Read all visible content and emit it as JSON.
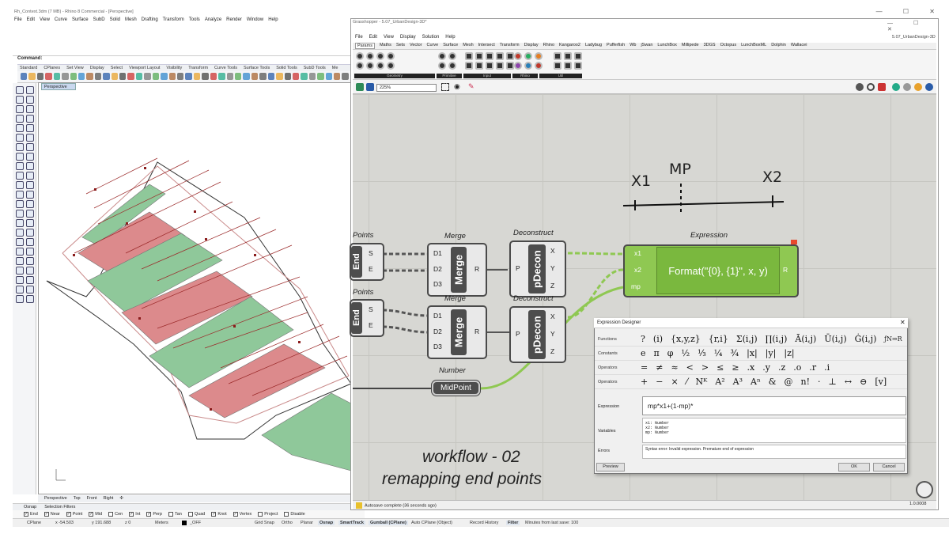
{
  "rhino": {
    "title": "Rh_Context.3dm (7 MB) - Rhino 8 Commercial - [Perspective]",
    "window_controls": "— ☐ ✕",
    "menu": [
      "File",
      "Edit",
      "View",
      "Curve",
      "Surface",
      "SubD",
      "Solid",
      "Mesh",
      "Drafting",
      "Transform",
      "Tools",
      "Analyze",
      "Render",
      "Window",
      "Help"
    ],
    "command_label": "Command:",
    "toolbar_tabs": [
      "Standard",
      "CPlanes",
      "Set View",
      "Display",
      "Select",
      "Viewport Layout",
      "Visibility",
      "Transform",
      "Curve Tools",
      "Surface Tools",
      "Solid Tools",
      "SubD Tools",
      "Me"
    ],
    "viewport_label": "Perspective",
    "viewport_tabs": [
      "Perspective",
      "Top",
      "Front",
      "Right",
      "✣"
    ],
    "osnap_tabs": [
      "Osnap",
      "Selection Filters"
    ],
    "osnaps": [
      {
        "label": "End",
        "checked": true
      },
      {
        "label": "Near",
        "checked": true
      },
      {
        "label": "Point",
        "checked": true
      },
      {
        "label": "Mid",
        "checked": true
      },
      {
        "label": "Cen",
        "checked": false
      },
      {
        "label": "Int",
        "checked": true
      },
      {
        "label": "Perp",
        "checked": true
      },
      {
        "label": "Tan",
        "checked": false
      },
      {
        "label": "Quad",
        "checked": false
      },
      {
        "label": "Knot",
        "checked": true
      },
      {
        "label": "Vertex",
        "checked": true
      },
      {
        "label": "Project",
        "checked": false
      },
      {
        "label": "Disable",
        "checked": false
      }
    ],
    "status": {
      "cplane": "CPlane",
      "x": "x -54.503",
      "y": "y 191.688",
      "z": "z 0",
      "units": "Meters",
      "layer": "_OFF",
      "grid_snap": "Grid Snap",
      "ortho": "Ortho",
      "planar": "Planar",
      "osnap": "Osnap",
      "smarttrack": "SmartTrack",
      "gumball": "Gumball (CPlane)",
      "autocplane": "Auto CPlane (Object)",
      "record": "Record History",
      "filter": "Filter",
      "save": "Minutes from last save: 100"
    }
  },
  "gh": {
    "title": "Grasshopper - 5.07_UrbanDesign-3D*",
    "project": "5.07_UrbanDesign-3D",
    "window_controls": "— ☐ ✕",
    "menu": [
      "File",
      "Edit",
      "View",
      "Display",
      "Solution",
      "Help"
    ],
    "tabs": [
      "Params",
      "Maths",
      "Sets",
      "Vector",
      "Curve",
      "Surface",
      "Mesh",
      "Intersect",
      "Transform",
      "Display",
      "Rhino",
      "Kangaroo2",
      "Ladybug",
      "Pufferfish",
      "Wb",
      "jSwan",
      "LunchBox",
      "Millipede",
      "3DGS",
      "Octopus",
      "LunchBoxML",
      "Dolphin",
      "Wallacei"
    ],
    "ribbon_groups": [
      "Geometry",
      "Primitive",
      "Input",
      "Rhino",
      "Util"
    ],
    "zoom": "225%",
    "autosave": "Autosave complete (36 seconds ago)",
    "version": "1.0.0008",
    "canvas": {
      "handwriting": {
        "x1": "X1",
        "mp": "MP",
        "x2": "X2"
      },
      "points_label_1": "Points",
      "points_label_2": "Points",
      "end_label": "End",
      "pin_s": "S",
      "pin_e": "E",
      "merge_group": "Merge",
      "merge_label": "Merge",
      "merge_inputs": [
        "D1",
        "D2",
        "D3"
      ],
      "merge_output": "R",
      "deconstruct_group": "Deconstruct",
      "pdecon_label": "pDecon",
      "pdecon_input": "P",
      "pdecon_outputs": [
        "X",
        "Y",
        "Z"
      ],
      "expression_group": "Expression",
      "expr_inputs": [
        "x1",
        "x2",
        "mp"
      ],
      "expr_text": "Format(\"{0}, {1}\", x, y)",
      "expr_output": "R",
      "number_group": "Number",
      "midpoint": "MidPoint"
    },
    "designer": {
      "title": "Expression Designer",
      "rows": [
        {
          "label": "Functions",
          "symbols": [
            "?",
            "(i)",
            "{x,y,z}",
            "{r,i}",
            "Σ(i,j)",
            "∏(i,j)",
            "Ā(i,j)",
            "Ū(i,j)",
            "Ġ(i,j)"
          ]
        },
        {
          "label": "Constants",
          "symbols": [
            "e",
            "π",
            "φ",
            "½",
            "⅓",
            "¼",
            "¾",
            "|x|",
            "|y|",
            "|z|"
          ]
        },
        {
          "label": "Operators",
          "symbols": [
            "=",
            "≠",
            "≈",
            "<",
            ">",
            "≤",
            "≥",
            ".x",
            ".y",
            ".z",
            ".o",
            ".r",
            ".i"
          ]
        },
        {
          "label": "Operators",
          "symbols": [
            "+",
            "−",
            "×",
            "⁄",
            "Nᴷ",
            "A²",
            "A³",
            "Aⁿ",
            "&",
            "@",
            "n!",
            "·",
            "⊥",
            "↔",
            "⊖",
            "[v]"
          ]
        }
      ],
      "fn_right": "ƒN⇒R",
      "expression_label": "Expression",
      "expression": "mp*x1+(1-mp)*",
      "variables_label": "Variables",
      "variables": [
        "x1: Number",
        "x2: Number",
        "mp: Number"
      ],
      "errors_label": "Errors",
      "error": "Syntax error: Invalid expression. Premature end of expression",
      "preview": "Preview",
      "ok": "OK",
      "cancel": "Cancel"
    }
  },
  "overlay": {
    "line1": "workflow - 02",
    "line2": "remapping end points"
  },
  "colors": {
    "green_zone": "#8fc89a",
    "red_zone": "#dc8a8c",
    "expression_green": "#8fc852",
    "canvas": "#d7d7d3"
  }
}
